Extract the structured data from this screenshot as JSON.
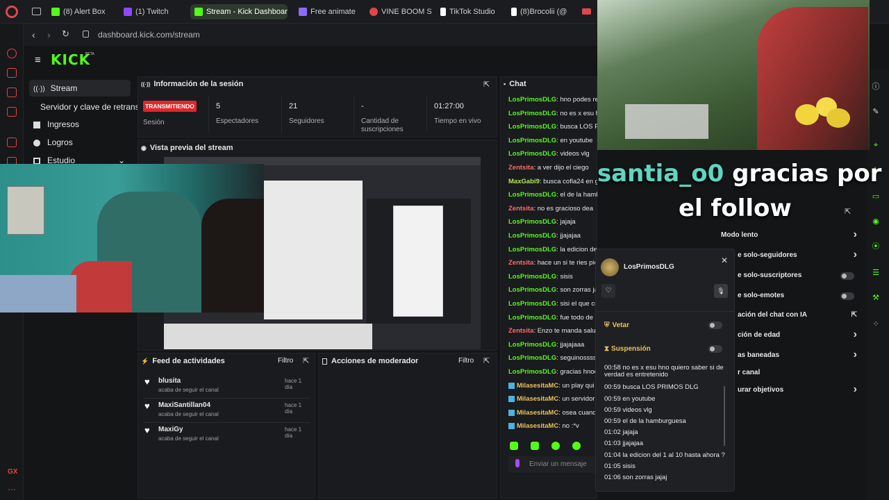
{
  "browser": {
    "tabs": [
      {
        "label": "(8) Alert Box",
        "color": "#53fc18"
      },
      {
        "label": "(1) Twitch",
        "color": "#9146ff"
      },
      {
        "label": "Stream - Kick Dashboar",
        "color": "#53fc18"
      },
      {
        "label": "Free animate",
        "color": "#8a6cff"
      },
      {
        "label": "VINE BOOM S",
        "color": "#e0464b"
      },
      {
        "label": "TikTok Studio",
        "color": "#ffffff"
      },
      {
        "label": "(8)Brocolii (@",
        "color": "#ffffff"
      }
    ],
    "url": "dashboard.kick.com/stream"
  },
  "brand": {
    "logo": "KICK",
    "beta": "BETA",
    "accent": "#53fc18"
  },
  "nav": {
    "items": [
      {
        "label": "Stream",
        "icon": "broadcast-icon"
      },
      {
        "label": "Servidor y clave de retransm",
        "icon": ""
      },
      {
        "label": "Ingresos",
        "icon": "grid-icon"
      },
      {
        "label": "Logros",
        "icon": "trophy-icon"
      },
      {
        "label": "Estudio",
        "icon": "studio-icon"
      }
    ]
  },
  "session": {
    "title": "Información de la sesión",
    "status_badge": "TRANSMITIENDO",
    "status_label": "Sesión",
    "stats": [
      {
        "value": "5",
        "label": "Espectadores"
      },
      {
        "value": "21",
        "label": "Seguidores"
      },
      {
        "value": "-",
        "label": "Cantidad de suscripciones"
      },
      {
        "value": "01:27:00",
        "label": "Tiempo en vivo"
      }
    ]
  },
  "preview": {
    "title": "Vista previa del stream"
  },
  "activity": {
    "title": "Feed de actividades",
    "filter": "Filtro",
    "items": [
      {
        "name": "blusita",
        "action": "acaba de seguir el canal",
        "time": "hace 1 día"
      },
      {
        "name": "MaxiSantillan04",
        "action": "acaba de seguir el canal",
        "time": "hace 1 día"
      },
      {
        "name": "MaxiGy",
        "action": "acaba de seguir el canal",
        "time": "hace 1 día"
      }
    ]
  },
  "moderator": {
    "title": "Acciones de moderador",
    "filter": "Filtro"
  },
  "chat": {
    "title": "Chat",
    "input_placeholder": "Enviar un mensaje",
    "messages": [
      {
        "user": "LosPrimosDLG",
        "text": "hno podes reacci",
        "cls": "g"
      },
      {
        "user": "LosPrimosDLG",
        "text": "no es x esu hno c",
        "cls": "g"
      },
      {
        "user": "LosPrimosDLG",
        "text": "busca LOS PRIMO",
        "cls": "g"
      },
      {
        "user": "LosPrimosDLG",
        "text": "en youtube",
        "cls": "g"
      },
      {
        "user": "LosPrimosDLG",
        "text": "videos vlg",
        "cls": "g"
      },
      {
        "user": "Zentsita",
        "text": "a ver dijo el ciego",
        "cls": "p"
      },
      {
        "user": "MaxGabi9",
        "text": "busca cofla24 en goog",
        "cls": "m"
      },
      {
        "user": "LosPrimosDLG",
        "text": "el de la hamburguesa",
        "cls": "g"
      },
      {
        "user": "Zentsita",
        "text": "no es gracioso dea",
        "cls": "p"
      },
      {
        "user": "LosPrimosDLG",
        "text": "jajaja",
        "cls": "g"
      },
      {
        "user": "LosPrimosDLG",
        "text": "jjajajaa",
        "cls": "g"
      },
      {
        "user": "LosPrimosDLG",
        "text": "la edicion del",
        "cls": "g"
      },
      {
        "user": "Zentsita",
        "text": "hace un si te ries pie",
        "cls": "p"
      },
      {
        "user": "LosPrimosDLG",
        "text": "sisis",
        "cls": "g"
      },
      {
        "user": "LosPrimosDLG",
        "text": "son zorras jaj",
        "cls": "g"
      },
      {
        "user": "LosPrimosDLG",
        "text": "sisi el que co",
        "cls": "g"
      },
      {
        "user": "LosPrimosDLG",
        "text": "fue todo de c",
        "cls": "g"
      },
      {
        "user": "Zentsita",
        "text": "Enzo te manda salud",
        "cls": "p"
      },
      {
        "user": "LosPrimosDLG",
        "text": "jjajajaaa",
        "cls": "g"
      },
      {
        "user": "LosPrimosDLG",
        "text": "seguinosssss",
        "cls": "g"
      },
      {
        "user": "LosPrimosDLG",
        "text": "gracias hnoo",
        "cls": "g"
      },
      {
        "user": "MilasesitaMC",
        "text": "un play qui",
        "cls": "y"
      },
      {
        "user": "MilasesitaMC",
        "text": "un servidor",
        "cls": "y"
      },
      {
        "user": "MilasesitaMC",
        "text": "osea cuand",
        "cls": "y"
      },
      {
        "user": "MilasesitaMC",
        "text": "no :*v",
        "cls": "y"
      }
    ]
  },
  "overlay": {
    "username": "santia_o0",
    "line1": " gracias por",
    "line2": "el follow"
  },
  "settings": {
    "items": [
      {
        "label": "Modo lento",
        "control": "chevron"
      },
      {
        "label": "e solo-seguidores",
        "control": "chevron"
      },
      {
        "label": "e solo-suscriptores",
        "control": "toggle"
      },
      {
        "label": "e solo-emotes",
        "control": "toggle"
      },
      {
        "label": "ación del chat con IA",
        "control": "external"
      },
      {
        "label": "ción de edad",
        "control": "chevron"
      },
      {
        "label": "as baneadas",
        "control": "chevron"
      },
      {
        "label": "r canal",
        "control": "none"
      },
      {
        "label": "urar objetivos",
        "control": "chevron"
      }
    ]
  },
  "user_card": {
    "name": "LosPrimosDLG",
    "ban_label": "Vetar",
    "timeout_label": "Suspensión",
    "log": [
      "00:58 no es x esu hno quiero saber si de",
      "verdad es entretenido",
      "00:59 busca LOS PRIMOS DLG",
      "00:59 en youtube",
      "00:59 videos vlg",
      "00:59 el de la hamburguesa",
      "01:02 jajaja",
      "01:03 jjajajaa",
      "01:04 la edicion del 1 al 10 hasta ahora ?",
      "01:05 sisis",
      "01:06 son zorras jajaj"
    ]
  }
}
